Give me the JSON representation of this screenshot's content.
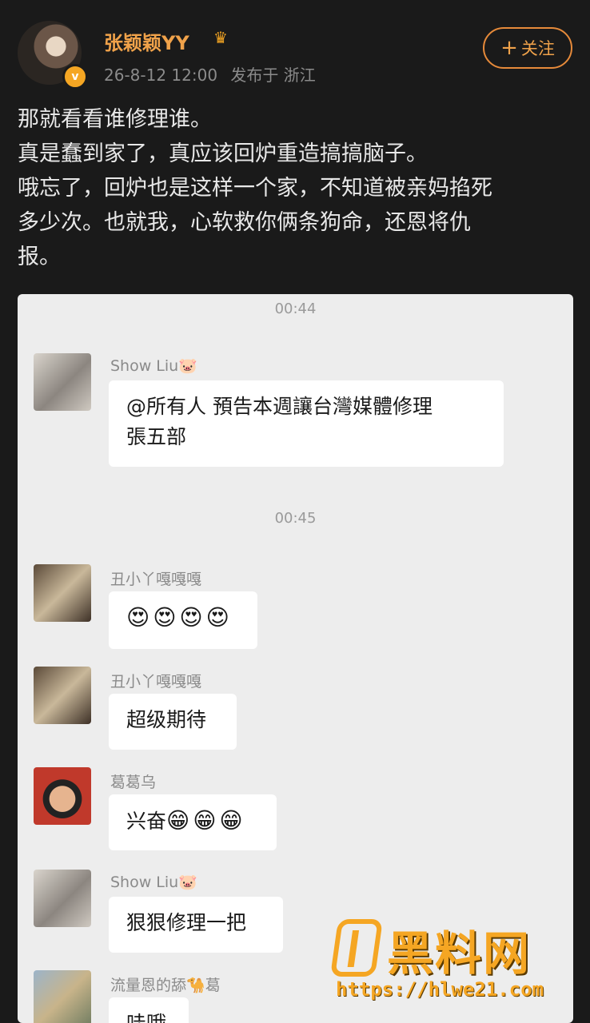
{
  "post": {
    "username": "张颖颖YY",
    "vip_icon": "vip-crown-icon",
    "verified_icon": "verified-v-icon",
    "verified_mark": "v",
    "date": "26-8-12 12:00",
    "published_from": "发布于 浙江",
    "follow_label": "关注",
    "follow_plus": "+",
    "text_lines": [
      "那就看看谁修理谁。",
      "真是蠢到家了，真应该回炉重造搞搞脑子。",
      "哦忘了，回炉也是这样一个家，不知道被亲妈掐死",
      "多少次。也就我，心软救你俩条狗命，还恩将仇",
      "报。"
    ]
  },
  "chat": {
    "time_1": "00:44",
    "time_2": "00:45",
    "messages": [
      {
        "sender": "Show Liu",
        "sender_icon": "pig-emoji",
        "text_line1": "@所有人  預告本週讓台灣媒體修理",
        "text_line2": "張五部"
      },
      {
        "sender": "丑小丫嘎嘎嘎",
        "emojis": [
          "heart-eyes-emoji",
          "heart-eyes-emoji",
          "heart-eyes-emoji",
          "heart-eyes-emoji"
        ]
      },
      {
        "sender": "丑小丫嘎嘎嘎",
        "text": "超级期待"
      },
      {
        "sender": "葛葛乌",
        "text": "兴奋",
        "emojis": [
          "grinning-emoji",
          "grinning-emoji",
          "grinning-emoji"
        ]
      },
      {
        "sender": "Show Liu",
        "sender_icon": "pig-emoji",
        "text": "狠狠修理一把"
      },
      {
        "sender_prefix": "流量恩的舔",
        "sender_suffix": "葛",
        "sender_icon": "camel-emoji",
        "text": "哇哦"
      }
    ]
  },
  "watermark": {
    "title": "黑料网",
    "url": "https://hlwe21.com"
  },
  "colors": {
    "background": "#1a1a1a",
    "accent_orange": "#f0a24a",
    "chat_bg": "#ededed",
    "bubble_bg": "#ffffff",
    "watermark": "#f5a623"
  }
}
